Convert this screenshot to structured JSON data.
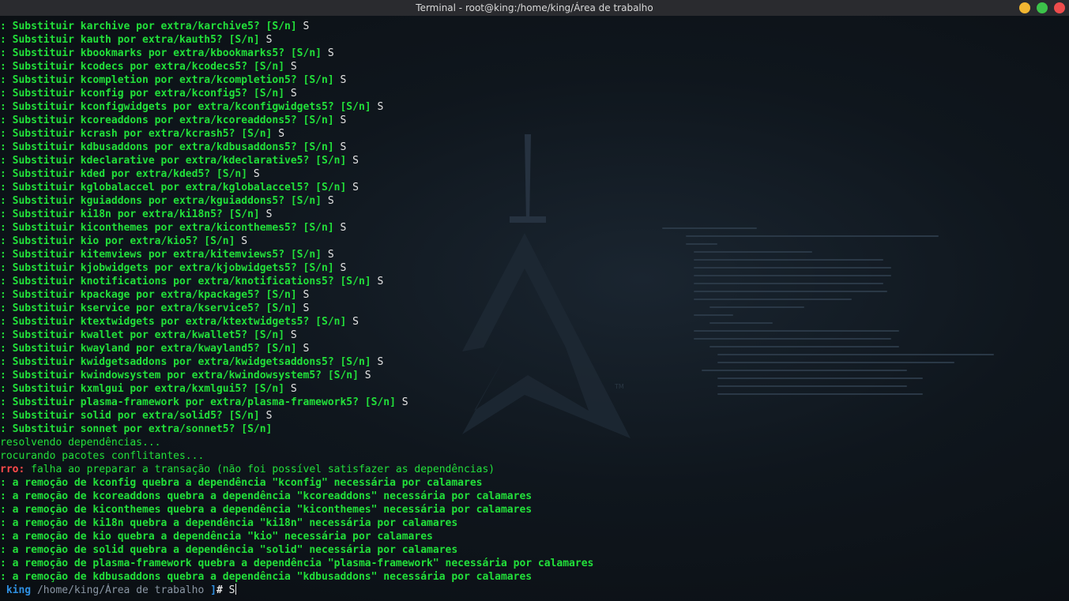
{
  "window": {
    "title": "Terminal - root@king:/home/king/Área de trabalho"
  },
  "icons": [
    "minimize-icon",
    "maximize-icon",
    "close-icon"
  ],
  "colors": {
    "prompt_green": "#22e03a",
    "error_red": "#ff4a4a",
    "user_blue": "#2e8fe0",
    "titlebar": "#2a2b2f"
  },
  "replace_lines": [
    {
      "text": ": Substituir karchive por extra/karchive5? [S/n]",
      "answer": "S"
    },
    {
      "text": ": Substituir kauth por extra/kauth5? [S/n]",
      "answer": "S"
    },
    {
      "text": ": Substituir kbookmarks por extra/kbookmarks5? [S/n]",
      "answer": "S"
    },
    {
      "text": ": Substituir kcodecs por extra/kcodecs5? [S/n]",
      "answer": "S"
    },
    {
      "text": ": Substituir kcompletion por extra/kcompletion5? [S/n]",
      "answer": "S"
    },
    {
      "text": ": Substituir kconfig por extra/kconfig5? [S/n]",
      "answer": "S"
    },
    {
      "text": ": Substituir kconfigwidgets por extra/kconfigwidgets5? [S/n]",
      "answer": "S"
    },
    {
      "text": ": Substituir kcoreaddons por extra/kcoreaddons5? [S/n]",
      "answer": "S"
    },
    {
      "text": ": Substituir kcrash por extra/kcrash5? [S/n]",
      "answer": "S"
    },
    {
      "text": ": Substituir kdbusaddons por extra/kdbusaddons5? [S/n]",
      "answer": "S"
    },
    {
      "text": ": Substituir kdeclarative por extra/kdeclarative5? [S/n]",
      "answer": "S"
    },
    {
      "text": ": Substituir kded por extra/kded5? [S/n]",
      "answer": "S"
    },
    {
      "text": ": Substituir kglobalaccel por extra/kglobalaccel5? [S/n]",
      "answer": "S"
    },
    {
      "text": ": Substituir kguiaddons por extra/kguiaddons5? [S/n]",
      "answer": "S"
    },
    {
      "text": ": Substituir ki18n por extra/ki18n5? [S/n]",
      "answer": "S"
    },
    {
      "text": ": Substituir kiconthemes por extra/kiconthemes5? [S/n]",
      "answer": "S"
    },
    {
      "text": ": Substituir kio por extra/kio5? [S/n]",
      "answer": "S"
    },
    {
      "text": ": Substituir kitemviews por extra/kitemviews5? [S/n]",
      "answer": "S"
    },
    {
      "text": ": Substituir kjobwidgets por extra/kjobwidgets5? [S/n]",
      "answer": "S"
    },
    {
      "text": ": Substituir knotifications por extra/knotifications5? [S/n]",
      "answer": "S"
    },
    {
      "text": ": Substituir kpackage por extra/kpackage5? [S/n]",
      "answer": "S"
    },
    {
      "text": ": Substituir kservice por extra/kservice5? [S/n]",
      "answer": "S"
    },
    {
      "text": ": Substituir ktextwidgets por extra/ktextwidgets5? [S/n]",
      "answer": "S"
    },
    {
      "text": ": Substituir kwallet por extra/kwallet5? [S/n]",
      "answer": "S"
    },
    {
      "text": ": Substituir kwayland por extra/kwayland5? [S/n]",
      "answer": "S"
    },
    {
      "text": ": Substituir kwidgetsaddons por extra/kwidgetsaddons5? [S/n]",
      "answer": "S"
    },
    {
      "text": ": Substituir kwindowsystem por extra/kwindowsystem5? [S/n]",
      "answer": "S"
    },
    {
      "text": ": Substituir kxmlgui por extra/kxmlgui5? [S/n]",
      "answer": "S"
    },
    {
      "text": ": Substituir plasma-framework por extra/plasma-framework5? [S/n]",
      "answer": "S"
    },
    {
      "text": ": Substituir solid por extra/solid5? [S/n]",
      "answer": "S"
    },
    {
      "text": ": Substituir sonnet por extra/sonnet5? [S/n]",
      "answer": ""
    }
  ],
  "status_lines": [
    "resolvendo dependências...",
    "rocurando pacotes conflitantes..."
  ],
  "error": {
    "label": "rro:",
    "message": " falha ao preparar a transação (não foi possível satisfazer as dependências)"
  },
  "dependency_lines": [
    ": a remoção de kconfig quebra a dependência \"kconfig\" necessária por calamares",
    ": a remoção de kcoreaddons quebra a dependência \"kcoreaddons\" necessária por calamares",
    ": a remoção de kiconthemes quebra a dependência \"kiconthemes\" necessária por calamares",
    ": a remoção de ki18n quebra a dependência \"ki18n\" necessária por calamares",
    ": a remoção de kio quebra a dependência \"kio\" necessária por calamares",
    ": a remoção de solid quebra a dependência \"solid\" necessária por calamares",
    ": a remoção de plasma-framework quebra a dependência \"plasma-framework\" necessária por calamares",
    ": a remoção de kdbusaddons quebra a dependência \"kdbusaddons\" necessária por calamares"
  ],
  "prompt": {
    "user": " king",
    "path": " /home/king/Área de trabalho",
    "close": " ]",
    "symbol": "#",
    "input": " S"
  }
}
